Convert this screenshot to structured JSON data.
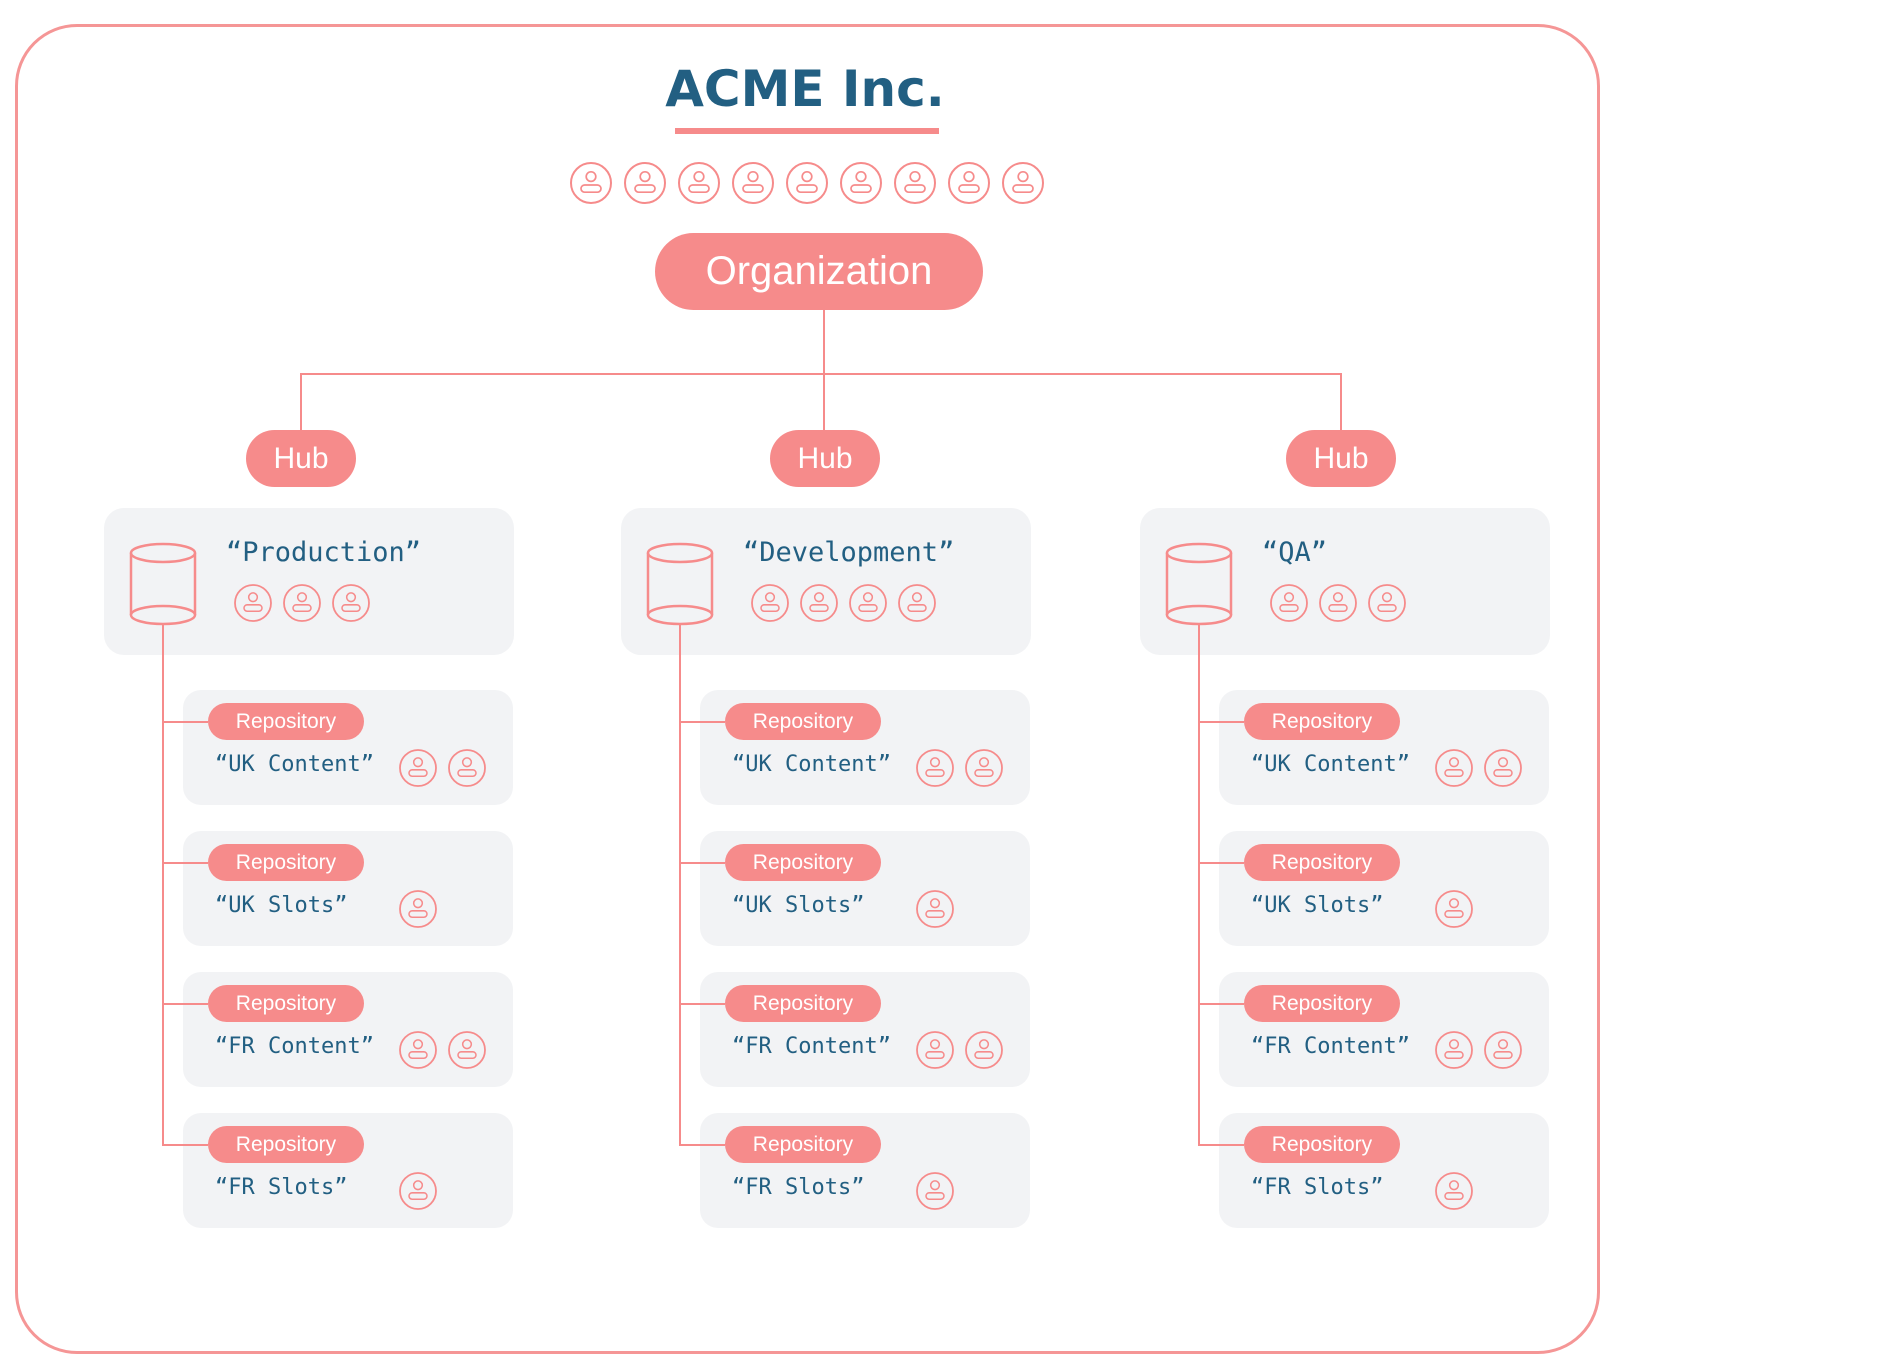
{
  "organization": {
    "title": "ACME Inc.",
    "label": "Organization",
    "member_count": 9
  },
  "colors": {
    "accent": "#f68b8b",
    "title": "#225f82",
    "card_bg": "#f2f3f5",
    "frame": "#f59696"
  },
  "icons": {
    "member": "person-icon",
    "hub": "database-cylinder-icon"
  },
  "hubs": [
    {
      "label": "Hub",
      "name": "“Production”",
      "member_count": 3,
      "repositories": [
        {
          "label": "Repository",
          "name": "“UK Content”",
          "member_count": 2
        },
        {
          "label": "Repository",
          "name": "“UK Slots”",
          "member_count": 1
        },
        {
          "label": "Repository",
          "name": "“FR Content”",
          "member_count": 2
        },
        {
          "label": "Repository",
          "name": "“FR Slots”",
          "member_count": 1
        }
      ]
    },
    {
      "label": "Hub",
      "name": "“Development”",
      "member_count": 4,
      "repositories": [
        {
          "label": "Repository",
          "name": "“UK Content”",
          "member_count": 2
        },
        {
          "label": "Repository",
          "name": "“UK Slots”",
          "member_count": 1
        },
        {
          "label": "Repository",
          "name": "“FR Content”",
          "member_count": 2
        },
        {
          "label": "Repository",
          "name": "“FR Slots”",
          "member_count": 1
        }
      ]
    },
    {
      "label": "Hub",
      "name": "“QA”",
      "member_count": 3,
      "repositories": [
        {
          "label": "Repository",
          "name": "“UK Content”",
          "member_count": 2
        },
        {
          "label": "Repository",
          "name": "“UK Slots”",
          "member_count": 1
        },
        {
          "label": "Repository",
          "name": "“FR Content”",
          "member_count": 2
        },
        {
          "label": "Repository",
          "name": "“FR Slots”",
          "member_count": 1
        }
      ]
    }
  ]
}
